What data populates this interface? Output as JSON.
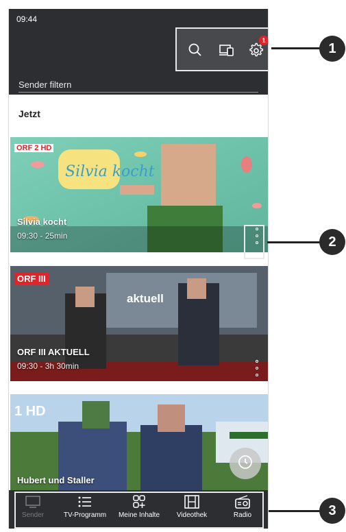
{
  "status_bar": {
    "time": "09:44"
  },
  "header": {
    "filter_placeholder": "Sender filtern",
    "settings_badge": "1",
    "icons": [
      "search-icon",
      "devices-icon",
      "settings-icon"
    ]
  },
  "section": {
    "title": "Jetzt"
  },
  "cards": [
    {
      "logo": "ORF 2 HD",
      "show_art_text": "Silvia kocht",
      "title": "Silvia kocht",
      "time": "09:30 - 25min"
    },
    {
      "logo": "ORF III",
      "show_art_text": "aktuell",
      "title": "ORF III AKTUELL",
      "time": "09:30 - 3h 30min"
    },
    {
      "logo": "1 HD",
      "title": "Hubert und Staller"
    }
  ],
  "bottom_nav": [
    {
      "label": "Sender",
      "icon": "tv-icon",
      "active": false
    },
    {
      "label": "TV-Programm",
      "icon": "list-icon",
      "active": true
    },
    {
      "label": "Meine Inhalte",
      "icon": "grid-add-icon",
      "active": true
    },
    {
      "label": "Videothek",
      "icon": "film-icon",
      "active": true
    },
    {
      "label": "Radio",
      "icon": "radio-icon",
      "active": true
    }
  ],
  "callouts": [
    "1",
    "2",
    "3"
  ],
  "colors": {
    "header_bg": "#2c2e31",
    "badge": "#e1232a",
    "callout": "#2b2b2b"
  }
}
